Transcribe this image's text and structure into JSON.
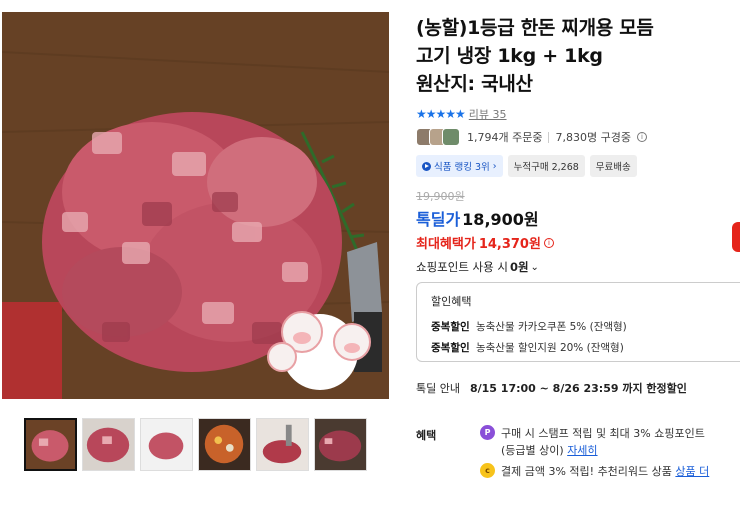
{
  "product": {
    "title_line1": "(농할)1등급 한돈 찌개용 모듬",
    "title_line2": "고기 냉장 1kg + 1kg",
    "title_line3": "원산지: 국내산"
  },
  "rating": {
    "stars": "★★★★★",
    "review_label": "리뷰 35"
  },
  "stats": {
    "orders": "1,794개 주문중",
    "subscribers": "7,830명 구경중"
  },
  "tags": [
    {
      "label": "식품 랭킹 3위",
      "chevron": "›"
    },
    {
      "label": "누적구매 2,268"
    },
    {
      "label": "무료배송"
    }
  ],
  "price": {
    "original": "19,900원",
    "sale_label": "톡딜가",
    "sale_price": "18,900원",
    "max_benefit_label": "최대혜택가",
    "max_benefit_price": "14,370원"
  },
  "points": {
    "label": "쇼핑포인트 사용 시",
    "value": "0원",
    "chevron": "⌄"
  },
  "discount": {
    "title": "할인혜택",
    "lines": [
      {
        "kind": "중복할인",
        "text": "농축산물 카카오쿠폰 5% (잔액형)"
      },
      {
        "kind": "중복할인",
        "text": "농축산물 할인지원 20% (잔액형)"
      }
    ]
  },
  "timed_deal": {
    "label": "톡딜 안내",
    "value": "8/15 17:00 ~ 8/26 23:59 까지 한정할인"
  },
  "benefits": {
    "label": "혜택",
    "item1_icon": "P",
    "item1_line1": "구매 시 스탬프 적립 및 최대 3% 쇼핑포인트",
    "item1_line2": "(등급별 상이)",
    "item1_link": "자세히",
    "item2_text": "결제 금액 3% 적립! 추천리워드 상품",
    "item2_link": "상품 더"
  },
  "icons": {
    "info": "i",
    "coin": "c"
  },
  "colors": {
    "accent_blue": "#1a5ed8",
    "accent_red": "#e5251b",
    "star_blue": "#1a73e8"
  }
}
